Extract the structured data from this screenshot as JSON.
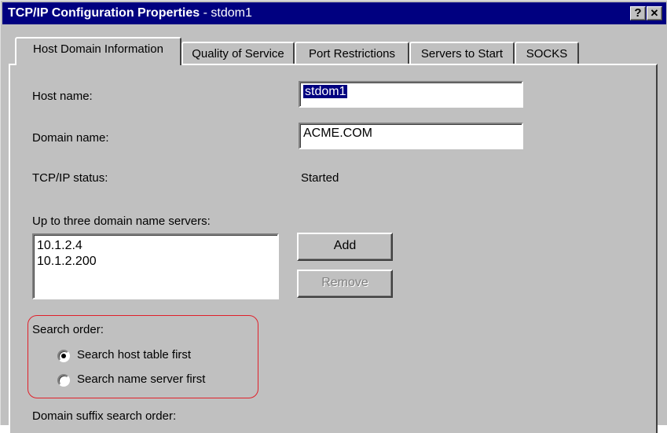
{
  "window": {
    "title_bold": "TCP/IP Configuration Properties",
    "title_rest": " - stdom1",
    "help_glyph": "?",
    "close_glyph": "✕"
  },
  "tabs": [
    {
      "label": "Host Domain Information",
      "active": true
    },
    {
      "label": "Quality of Service",
      "active": false
    },
    {
      "label": "Port Restrictions",
      "active": false
    },
    {
      "label": "Servers to Start",
      "active": false
    },
    {
      "label": "SOCKS",
      "active": false
    }
  ],
  "form": {
    "host_name_label": "Host name:",
    "host_name_value": "stdom1",
    "domain_name_label": "Domain name:",
    "domain_name_value": "ACME.COM",
    "status_label": "TCP/IP status:",
    "status_value": "Started",
    "dns_label": "Up to three domain name servers:",
    "dns_servers": [
      "10.1.2.4",
      "10.1.2.200"
    ],
    "add_button": "Add",
    "remove_button": "Remove",
    "search_order_label": "Search order:",
    "search_options": [
      {
        "label": "Search host table first",
        "selected": true
      },
      {
        "label": "Search name server first",
        "selected": false
      }
    ],
    "suffix_label": "Domain suffix search order:"
  },
  "colors": {
    "titlebar": "#000080",
    "highlight": "#e0202a"
  }
}
